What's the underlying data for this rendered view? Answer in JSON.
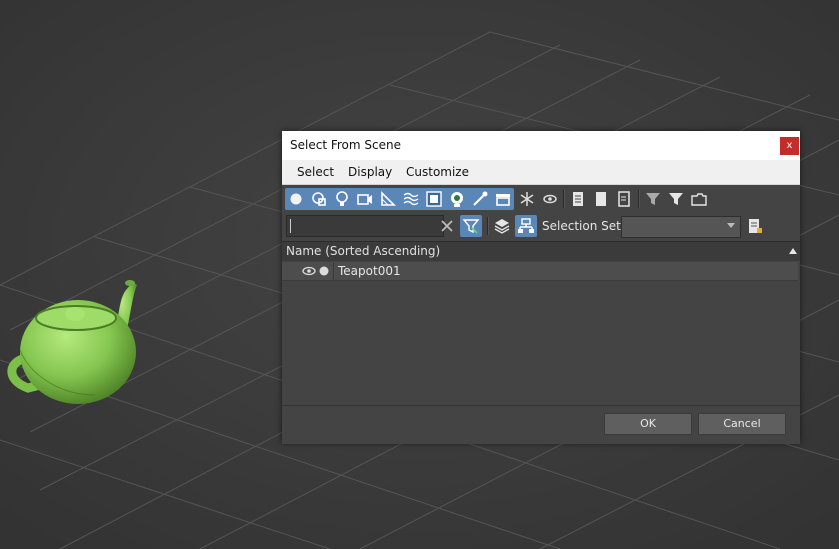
{
  "dialog": {
    "title": "Select From Scene",
    "close_glyph": "x",
    "menu": [
      "Select",
      "Display",
      "Customize"
    ],
    "toolbar1_icons": [
      "geometry-filter-icon",
      "shapes-filter-icon",
      "lights-filter-icon",
      "cameras-filter-icon",
      "helpers-filter-icon",
      "space-warps-filter-icon",
      "groups-filter-icon",
      "xrefs-filter-icon",
      "bones-filter-icon",
      "containers-filter-icon",
      "frozen-icon",
      "visibility-icon",
      "list-icon",
      "page-icon",
      "details-icon",
      "filter-funnel-icon",
      "funnel-icon",
      "folder-icon"
    ],
    "search": {
      "value": "",
      "placeholder": ""
    },
    "selection_set_label": "Selection Set:",
    "selection_set_value": "",
    "list": {
      "column_header": "Name (Sorted Ascending)",
      "rows": [
        {
          "name": "Teapot001"
        }
      ]
    },
    "ok_label": "OK",
    "cancel_label": "Cancel"
  },
  "scene": {
    "object": "teapot",
    "object_color": "#8fd05a",
    "background_color": "#3a3a3a",
    "grid_color": "#4d4d4d"
  }
}
